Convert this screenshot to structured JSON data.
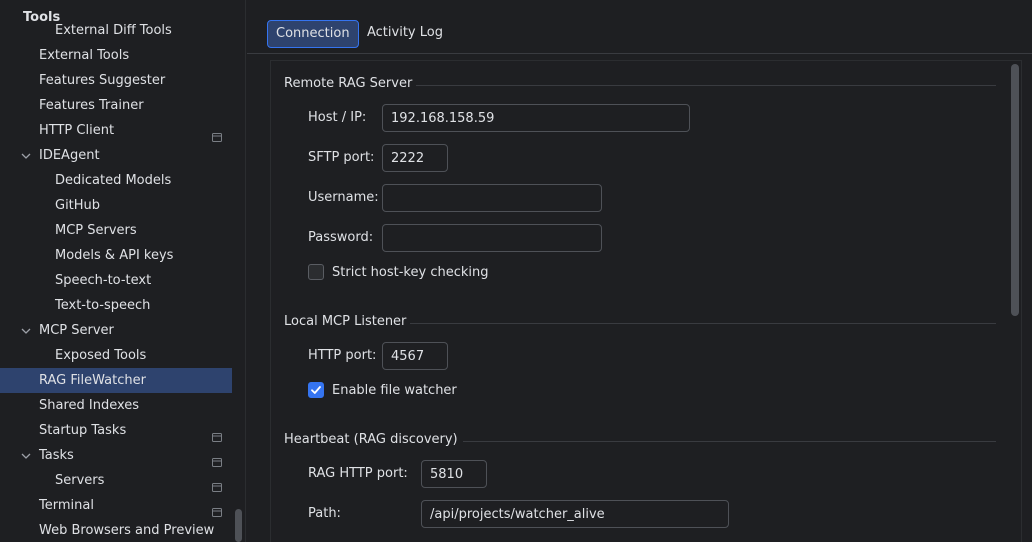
{
  "sidebar": {
    "header": "Tools",
    "items": [
      {
        "label": "External Diff Tools",
        "indent": 2
      },
      {
        "label": "External Tools",
        "indent": 1
      },
      {
        "label": "Features Suggester",
        "indent": 1
      },
      {
        "label": "Features Trainer",
        "indent": 1
      },
      {
        "label": "HTTP Client",
        "indent": 1,
        "project_icon": "project-settings-icon"
      },
      {
        "label": "IDEAgent",
        "indent": 1,
        "expanded": true
      },
      {
        "label": "Dedicated Models",
        "indent": 2
      },
      {
        "label": "GitHub",
        "indent": 2
      },
      {
        "label": "MCP Servers",
        "indent": 2
      },
      {
        "label": "Models & API keys",
        "indent": 2
      },
      {
        "label": "Speech-to-text",
        "indent": 2
      },
      {
        "label": "Text-to-speech",
        "indent": 2
      },
      {
        "label": "MCP Server",
        "indent": 1,
        "expanded": true
      },
      {
        "label": "Exposed Tools",
        "indent": 2
      },
      {
        "label": "RAG FileWatcher",
        "indent": 1,
        "selected": true
      },
      {
        "label": "Shared Indexes",
        "indent": 1
      },
      {
        "label": "Startup Tasks",
        "indent": 1,
        "project_icon": "project-settings-icon"
      },
      {
        "label": "Tasks",
        "indent": 1,
        "expanded": true,
        "project_icon": "project-settings-icon"
      },
      {
        "label": "Servers",
        "indent": 2,
        "project_icon": "project-settings-icon"
      },
      {
        "label": "Terminal",
        "indent": 1,
        "project_icon": "project-settings-icon"
      },
      {
        "label": "Web Browsers and Preview",
        "indent": 1
      }
    ]
  },
  "tabs": [
    {
      "label": "Connection",
      "active": true
    },
    {
      "label": "Activity Log",
      "active": false
    }
  ],
  "remote": {
    "title": "Remote RAG Server",
    "host_label": "Host / IP:",
    "host_value": "192.168.158.59",
    "sftp_label": "SFTP port:",
    "sftp_value": "2222",
    "username_label": "Username:",
    "username_value": "",
    "password_label": "Password:",
    "password_value": "",
    "strict_label": "Strict host-key checking",
    "strict_checked": false
  },
  "local": {
    "title": "Local MCP Listener",
    "http_label": "HTTP port:",
    "http_value": "4567",
    "watcher_label": "Enable file watcher",
    "watcher_checked": true
  },
  "heartbeat": {
    "title": "Heartbeat (RAG discovery)",
    "rag_port_label": "RAG HTTP port:",
    "rag_port_value": "5810",
    "path_label": "Path:",
    "path_value": "/api/projects/watcher_alive"
  },
  "colors": {
    "background": "#1e1f22",
    "selection": "#2e436e",
    "accent": "#3574f0",
    "text": "#dfe1e5"
  }
}
